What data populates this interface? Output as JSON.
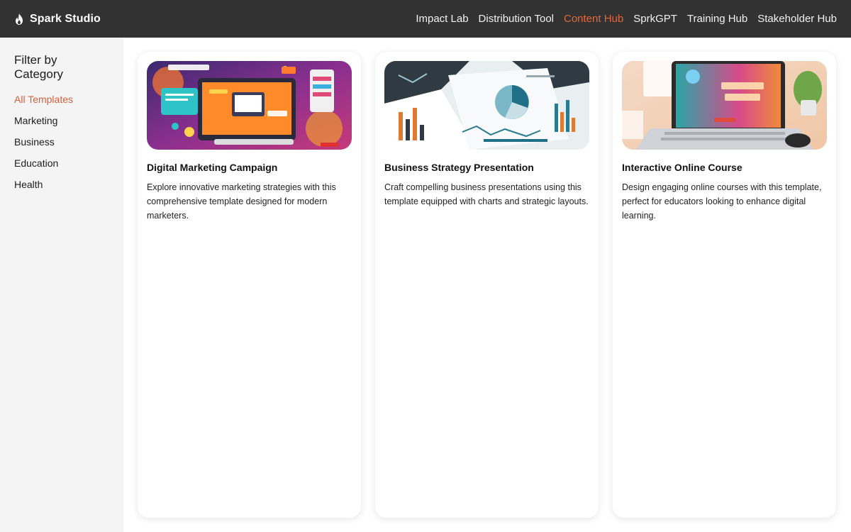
{
  "app": {
    "brand_name": "Spark Studio",
    "brand_icon": "flame-icon"
  },
  "nav": {
    "items": [
      {
        "label": "Impact Lab",
        "active": false
      },
      {
        "label": "Distribution Tool",
        "active": false
      },
      {
        "label": "Content Hub",
        "active": true
      },
      {
        "label": "SprkGPT",
        "active": false
      },
      {
        "label": "Training Hub",
        "active": false
      },
      {
        "label": "Stakeholder Hub",
        "active": false
      }
    ]
  },
  "sidebar": {
    "title": "Filter by Category",
    "items": [
      {
        "label": "All Templates",
        "active": true
      },
      {
        "label": "Marketing",
        "active": false
      },
      {
        "label": "Business",
        "active": false
      },
      {
        "label": "Education",
        "active": false
      },
      {
        "label": "Health",
        "active": false
      }
    ]
  },
  "cards": [
    {
      "title": "Digital Marketing Campaign",
      "description": "Explore innovative marketing strategies with this comprehensive template designed for modern marketers.",
      "image": "marketing-illustration"
    },
    {
      "title": "Business Strategy Presentation",
      "description": "Craft compelling business presentations using this template equipped with charts and strategic layouts.",
      "image": "business-charts-illustration"
    },
    {
      "title": "Interactive Online Course",
      "description": "Design engaging online courses with this template, perfect for educators looking to enhance digital learning.",
      "image": "online-course-illustration"
    }
  ],
  "colors": {
    "topbar": "#323232",
    "accent": "#e0673d",
    "sidebar_bg": "#f4f4f4"
  }
}
